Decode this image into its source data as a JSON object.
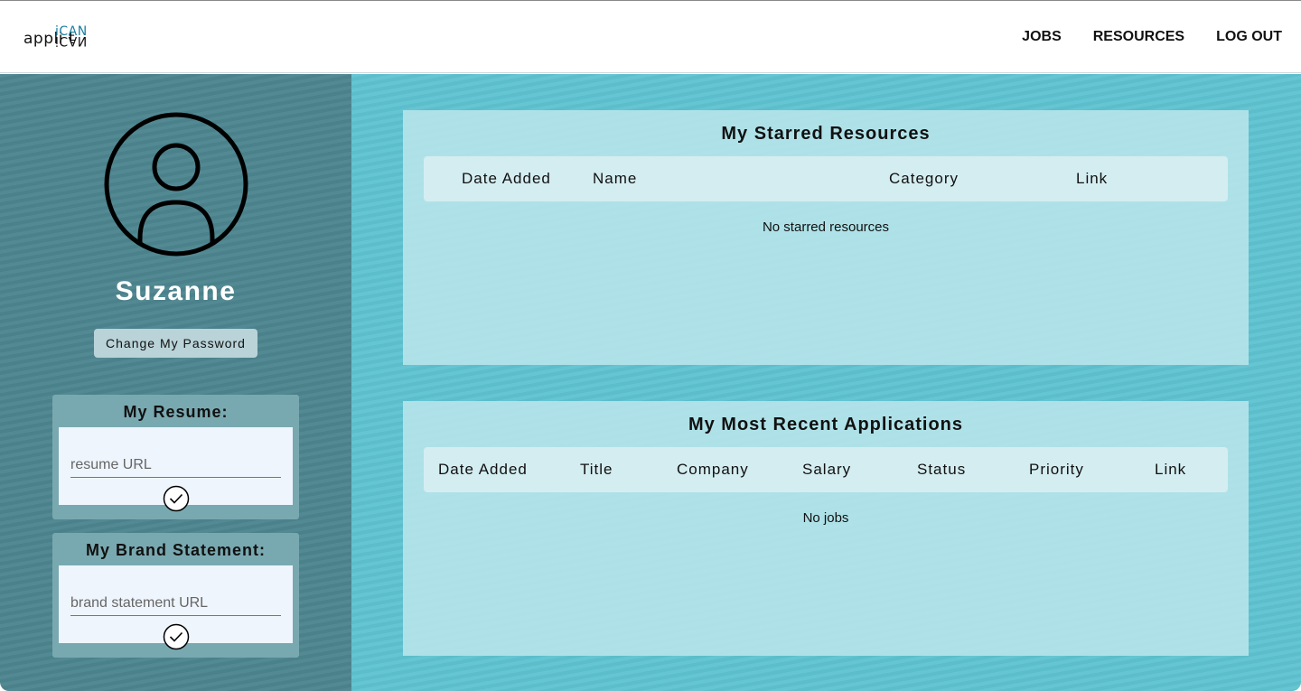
{
  "nav": {
    "logo_base": "appli    t",
    "logo_accent": "iCAN",
    "logo_mirror": "iCAN",
    "links": [
      "JOBS",
      "RESOURCES",
      "LOG OUT"
    ]
  },
  "profile": {
    "name": "Suzanne",
    "change_password_label": "Change My Password"
  },
  "resume": {
    "title": "My Resume:",
    "placeholder": "resume URL"
  },
  "brand": {
    "title": "My Brand Statement:",
    "placeholder": "brand statement URL"
  },
  "starred_resources": {
    "title": "My Starred Resources",
    "columns": [
      "Date Added",
      "Name",
      "Category",
      "Link"
    ],
    "empty_message": "No starred resources"
  },
  "recent_applications": {
    "title": "My Most Recent Applications",
    "columns": [
      "Date Added",
      "Title",
      "Company",
      "Salary",
      "Status",
      "Priority",
      "Link"
    ],
    "empty_message": "No jobs"
  },
  "colors": {
    "sidebar": "#4d858f",
    "main_background": "#5ec2d0",
    "logo_accent": "#1a7fa0"
  },
  "icons": {
    "avatar": "user-circle-icon",
    "submit": "check-circle-icon"
  }
}
